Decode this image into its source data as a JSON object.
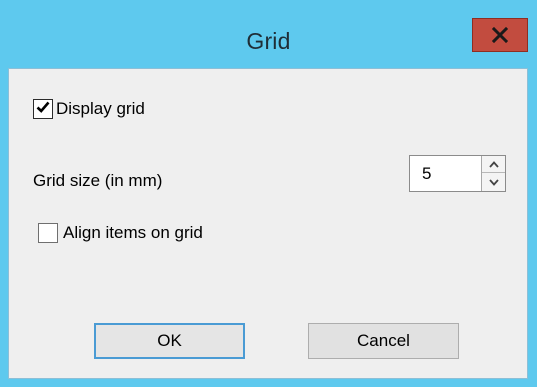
{
  "window": {
    "title": "Grid",
    "close_label": "x"
  },
  "options": {
    "display_grid": {
      "label": "Display grid",
      "checked": true
    },
    "grid_size": {
      "label": "Grid size (in mm)",
      "value": "5"
    },
    "align_items": {
      "label": "Align items on grid",
      "checked": false
    }
  },
  "buttons": {
    "ok_label": "OK",
    "cancel_label": "Cancel"
  },
  "icons": {
    "close": "close-icon",
    "check": "checkmark-icon",
    "spin_up": "chevron-up-icon",
    "spin_down": "chevron-down-icon"
  },
  "colors": {
    "title_bar": "#5ec9ee",
    "close_button": "#c24c3f",
    "dialog_body": "#efefef",
    "default_button_border": "#4a9bd4"
  }
}
